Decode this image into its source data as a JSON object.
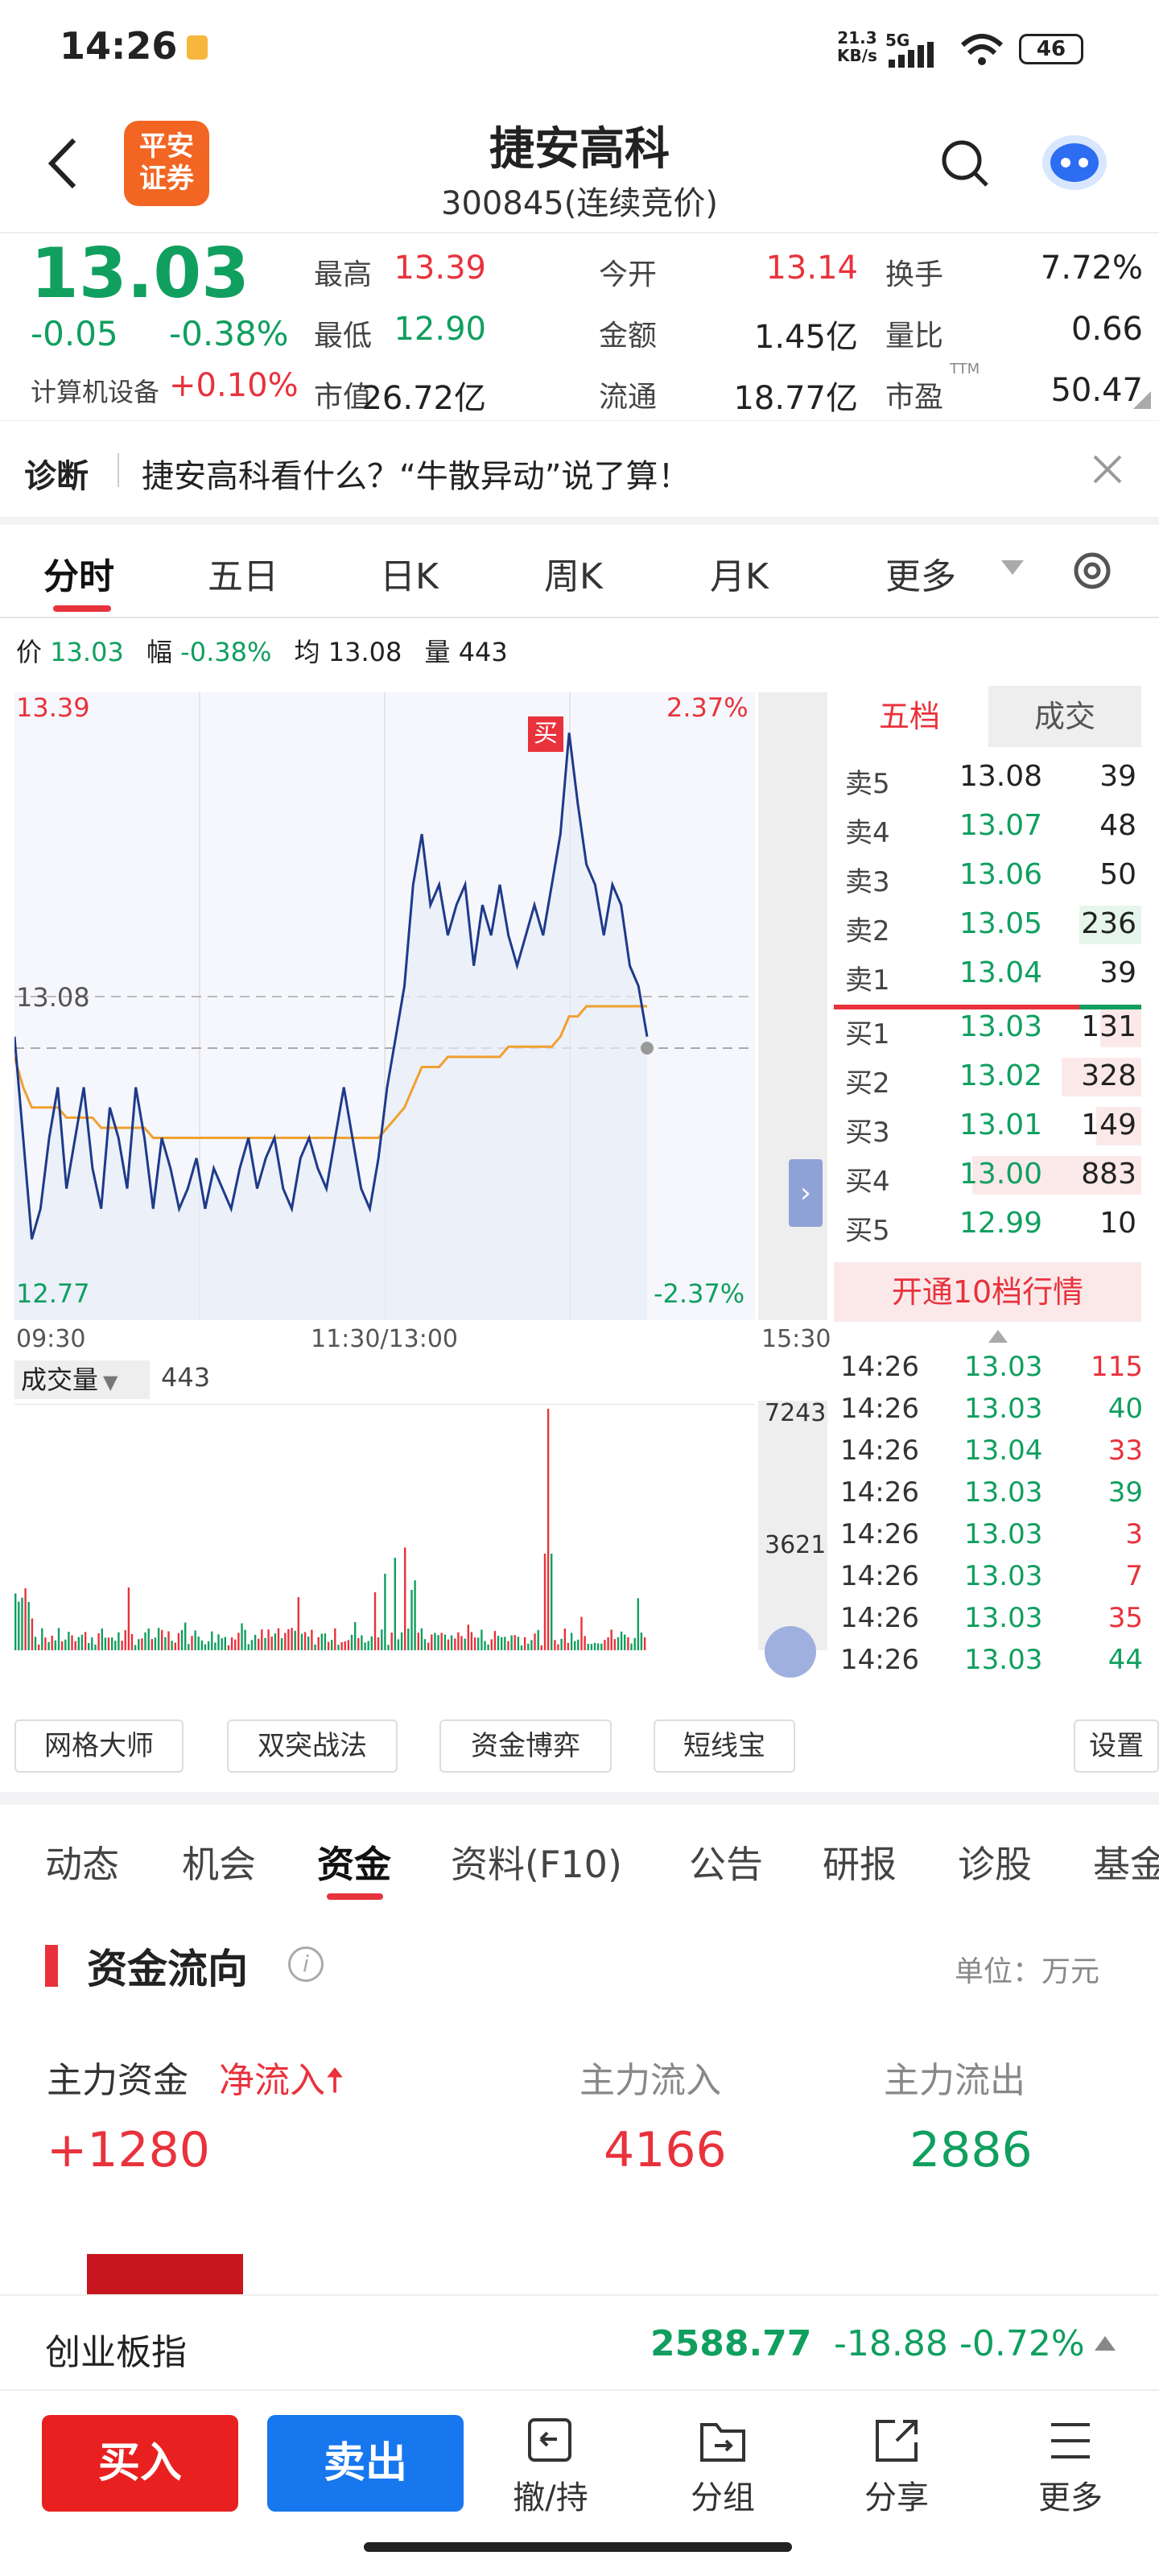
{
  "status": {
    "time": "14:26",
    "net_speed_top": "21.3",
    "net_speed_bottom": "KB/s",
    "net_type": "5G",
    "battery": "46"
  },
  "header": {
    "logo_line1": "平安",
    "logo_line2": "证券",
    "name": "捷安高科",
    "code": "300845",
    "trade_status": "(连续竞价)"
  },
  "quote": {
    "price": "13.03",
    "change": "-0.05",
    "change_pct": "-0.38%",
    "sector": "计算机设备",
    "sector_change": "+0.10%",
    "cells": [
      {
        "label": "最高",
        "value": "13.39",
        "color": "#e8323c"
      },
      {
        "label": "今开",
        "value": "13.14",
        "color": "#e8323c"
      },
      {
        "label": "换手",
        "value": "7.72%",
        "color": "#222222"
      },
      {
        "label": "最低",
        "value": "12.90",
        "color": "#109f5f"
      },
      {
        "label": "金额",
        "value": "1.45亿",
        "color": "#222222"
      },
      {
        "label": "量比",
        "value": "0.66",
        "color": "#222222"
      },
      {
        "label": "市值",
        "value": "26.72亿",
        "color": "#222222"
      },
      {
        "label": "流通",
        "value": "18.77亿",
        "color": "#222222"
      },
      {
        "label": "市盈",
        "value": "50.47",
        "color": "#222222",
        "sup": "TTM"
      }
    ]
  },
  "notice": {
    "tag": "诊断",
    "text": "捷安高科看什么？“牛散异动”说了算！"
  },
  "chart_tabs": [
    "分时",
    "五日",
    "日K",
    "周K",
    "月K",
    "更多"
  ],
  "info_line": {
    "price_label": "价",
    "price": "13.03",
    "amp_label": "幅",
    "amp": "-0.38%",
    "avg_label": "均",
    "avg": "13.08",
    "vol_label": "量",
    "vol": "443"
  },
  "chart_labels": {
    "top_left": "13.39",
    "top_right": "2.37%",
    "mid_left": "13.08",
    "bottom_left": "12.77",
    "bottom_right": "-2.37%",
    "time_start": "09:30",
    "time_mid": "11:30/13:00",
    "time_end": "15:30",
    "buy_marker": "买",
    "vol_label": "成交量",
    "vol_value": "443",
    "vol_max": "7243",
    "vol_mid": "3621"
  },
  "book": {
    "tab_five": "五档",
    "tab_trades": "成交",
    "asks": [
      {
        "label": "卖5",
        "price": "13.08",
        "vol": "39"
      },
      {
        "label": "卖4",
        "price": "13.07",
        "vol": "48"
      },
      {
        "label": "卖3",
        "price": "13.06",
        "vol": "50"
      },
      {
        "label": "卖2",
        "price": "13.05",
        "vol": "236"
      },
      {
        "label": "卖1",
        "price": "13.04",
        "vol": "39"
      }
    ],
    "bids": [
      {
        "label": "买1",
        "price": "13.03",
        "vol": "131"
      },
      {
        "label": "买2",
        "price": "13.02",
        "vol": "328"
      },
      {
        "label": "买3",
        "price": "13.01",
        "vol": "149"
      },
      {
        "label": "买4",
        "price": "13.00",
        "vol": "883"
      },
      {
        "label": "买5",
        "price": "12.99",
        "vol": "10"
      }
    ],
    "upgrade": "开通10档行情",
    "trades": [
      {
        "time": "14:26",
        "price": "13.03",
        "vol": "115",
        "dir": "buy"
      },
      {
        "time": "14:26",
        "price": "13.03",
        "vol": "40",
        "dir": "sell"
      },
      {
        "time": "14:26",
        "price": "13.04",
        "vol": "33",
        "dir": "buy"
      },
      {
        "time": "14:26",
        "price": "13.03",
        "vol": "39",
        "dir": "sell"
      },
      {
        "time": "14:26",
        "price": "13.03",
        "vol": "3",
        "dir": "buy"
      },
      {
        "time": "14:26",
        "price": "13.03",
        "vol": "7",
        "dir": "buy"
      },
      {
        "time": "14:26",
        "price": "13.03",
        "vol": "35",
        "dir": "buy"
      },
      {
        "time": "14:26",
        "price": "13.03",
        "vol": "44",
        "dir": "sell"
      }
    ]
  },
  "tools": [
    "网格大师",
    "双突战法",
    "资金博弈",
    "短线宝",
    "设置"
  ],
  "sub_tabs": [
    "动态",
    "机会",
    "资金",
    "资料(F10)",
    "公告",
    "研报",
    "诊股",
    "基金"
  ],
  "fund": {
    "title": "资金流向",
    "unit": "单位：万元",
    "main_label": "主力资金",
    "net_label": "净流入",
    "net_value": "+1280",
    "in_label": "主力流入",
    "in_value": "4166",
    "out_label": "主力流出",
    "out_value": "2886"
  },
  "index_bar": {
    "name": "创业板指",
    "value": "2588.77",
    "change": "-18.88",
    "pct": "-0.72%"
  },
  "bottom": {
    "buy": "买入",
    "sell": "卖出",
    "nav": [
      "撤/持",
      "分组",
      "分享",
      "更多"
    ]
  },
  "colors": {
    "red": "#e8323c",
    "green": "#109f5f",
    "blue": "#1e3a8a",
    "avg": "#f0a030",
    "buy_btn": "#e82020",
    "sell_btn": "#1677ee"
  },
  "chart_data": {
    "type": "line",
    "series": [],
    "ylim": [
      12.77,
      13.39
    ],
    "prev_close": 13.08,
    "price": [
      13.05,
      12.95,
      12.85,
      12.88,
      12.95,
      13.0,
      12.9,
      12.95,
      13.0,
      12.92,
      12.88,
      12.98,
      12.95,
      12.9,
      13.0,
      12.95,
      12.88,
      12.95,
      12.92,
      12.88,
      12.9,
      12.93,
      12.88,
      12.92,
      12.9,
      12.88,
      12.92,
      12.95,
      12.9,
      12.93,
      12.95,
      12.9,
      12.88,
      12.93,
      12.95,
      12.92,
      12.9,
      12.95,
      13.0,
      12.95,
      12.9,
      12.88,
      12.93,
      13.0,
      13.05,
      13.1,
      13.2,
      13.25,
      13.18,
      13.2,
      13.15,
      13.18,
      13.2,
      13.12,
      13.18,
      13.15,
      13.2,
      13.15,
      13.12,
      13.15,
      13.18,
      13.15,
      13.2,
      13.25,
      13.35,
      13.28,
      13.22,
      13.2,
      13.15,
      13.2,
      13.18,
      13.12,
      13.1,
      13.05
    ],
    "avg": [
      13.03,
      13.0,
      12.98,
      12.98,
      12.98,
      12.98,
      12.97,
      12.97,
      12.97,
      12.97,
      12.96,
      12.96,
      12.96,
      12.96,
      12.96,
      12.96,
      12.95,
      12.95,
      12.95,
      12.95,
      12.95,
      12.95,
      12.95,
      12.95,
      12.95,
      12.95,
      12.95,
      12.95,
      12.95,
      12.95,
      12.95,
      12.95,
      12.95,
      12.95,
      12.95,
      12.95,
      12.95,
      12.95,
      12.95,
      12.95,
      12.95,
      12.95,
      12.95,
      12.96,
      12.97,
      12.98,
      13.0,
      13.02,
      13.02,
      13.02,
      13.03,
      13.03,
      13.03,
      13.03,
      13.03,
      13.03,
      13.03,
      13.04,
      13.04,
      13.04,
      13.04,
      13.04,
      13.04,
      13.05,
      13.07,
      13.07,
      13.08,
      13.08,
      13.08,
      13.08,
      13.08,
      13.08,
      13.08,
      13.08
    ]
  }
}
